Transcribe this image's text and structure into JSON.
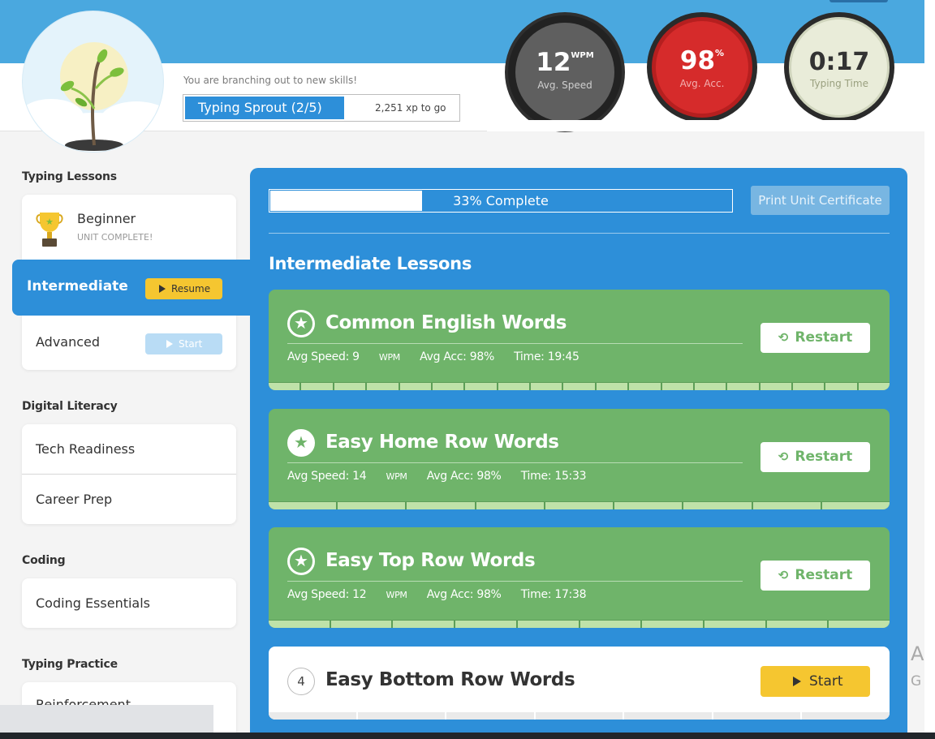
{
  "header": {
    "branch_message": "You are branching out to new skills!",
    "level_label": "Typing Sprout (2/5)",
    "xp_to_go": "2,251 xp to go"
  },
  "stats": {
    "speed_value": "12",
    "speed_unit": "WPM",
    "speed_label": "Avg. Speed",
    "accuracy_value": "98",
    "accuracy_unit": "%",
    "accuracy_label": "Avg. Acc.",
    "time_value": "0:17",
    "time_label": "Typing Time"
  },
  "sidebar": {
    "typing_lessons_title": "Typing Lessons",
    "beginner_label": "Beginner",
    "beginner_status": "UNIT COMPLETE!",
    "intermediate_label": "Intermediate",
    "resume_label": "Resume",
    "advanced_label": "Advanced",
    "start_label": "Start",
    "digital_literacy_title": "Digital Literacy",
    "tech_readiness_label": "Tech Readiness",
    "career_prep_label": "Career Prep",
    "coding_title": "Coding",
    "coding_essentials_label": "Coding Essentials",
    "typing_practice_title": "Typing Practice",
    "reinforcement_label": "Reinforcement"
  },
  "main": {
    "progress_percent": 33,
    "progress_text": "33% Complete",
    "print_button": "Print Unit Certificate",
    "section_title": "Intermediate Lessons",
    "restart_label": "Restart",
    "start_label": "Start",
    "lessons": [
      {
        "title": "Common English Words",
        "speed_text": "Avg Speed: 9 ",
        "speed_unit": "WPM",
        "acc_text": "Avg Acc: 98%",
        "time_text": "Time: 19:45",
        "segments": 19
      },
      {
        "title": "Easy Home Row Words",
        "speed_text": "Avg Speed: 14 ",
        "speed_unit": "WPM",
        "acc_text": "Avg Acc: 98%",
        "time_text": "Time: 15:33",
        "segments": 9
      },
      {
        "title": "Easy Top Row Words",
        "speed_text": "Avg Speed: 12 ",
        "speed_unit": "WPM",
        "acc_text": "Avg Acc: 98%",
        "time_text": "Time: 17:38",
        "segments": 10
      },
      {
        "number": "4",
        "title": "Easy Bottom Row Words",
        "segments": 7
      }
    ]
  },
  "right_edge": {
    "cut_a": "A",
    "cut_g": "G"
  },
  "colors": {
    "header_blue": "#4aa8df",
    "panel_blue": "#2d8fd9",
    "lesson_green": "#6fb46a",
    "yellow": "#f5c630",
    "accuracy_red": "#d62b2b"
  }
}
